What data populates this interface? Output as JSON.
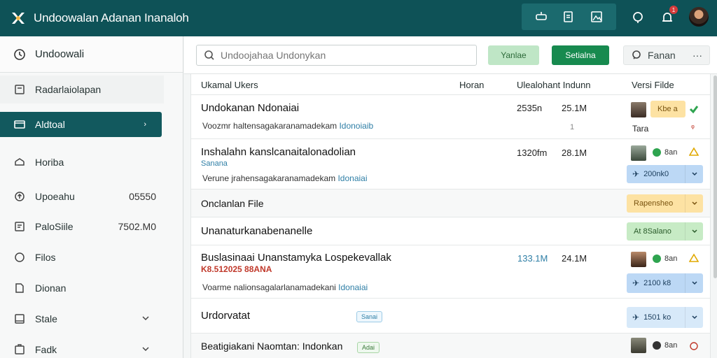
{
  "app": {
    "title": "Undoowalan Adanan Inanaloh",
    "notification_count": "1"
  },
  "topbar": {
    "icons": [
      "share-icon",
      "edit-icon",
      "image-icon",
      "help-icon",
      "bell-icon"
    ]
  },
  "sidebar": {
    "header": "Undoowali",
    "items": [
      {
        "label": "Radarlaiolapan",
        "icon": "card-icon",
        "value": ""
      },
      {
        "label": "Aldtoal",
        "icon": "folder-icon",
        "value": "",
        "active": true
      },
      {
        "label": "Horiba",
        "icon": "stack-icon",
        "value": ""
      },
      {
        "label": "Upoeahu",
        "icon": "upload-icon",
        "value": "05550"
      },
      {
        "label": "PaloSiile",
        "icon": "file-icon",
        "value": "7502.M0"
      },
      {
        "label": "Filos",
        "icon": "tag-icon",
        "value": ""
      },
      {
        "label": "Dionan",
        "icon": "doc-icon",
        "value": ""
      },
      {
        "label": "Stale",
        "icon": "list-icon",
        "value": "",
        "expand": true
      },
      {
        "label": "Fadk",
        "icon": "box-icon",
        "value": "",
        "expand": true
      }
    ]
  },
  "toolbar": {
    "search_placeholder": "Undoojahaa Undonykan",
    "btn_light": "Yanlae",
    "btn_dark": "Setialna",
    "btn_outline": "Fanan",
    "more": "···"
  },
  "table": {
    "headers": {
      "c1": "Ukamal Ukers",
      "c2": "Horan",
      "c3": "Ulealohant Indunn",
      "c4": "Versi Filde"
    },
    "rows": [
      {
        "title": "Undokanan Ndonaiai",
        "subtitle_main": "Voozmr haltensagakaranamadekam ",
        "subtitle_hl": "Idonoiaib",
        "c_time": "2535n",
        "c_size": "25.1M",
        "c_mini": "1",
        "pill": "Kbe a",
        "pill_style": "orange",
        "extra": "Tara"
      },
      {
        "title": "Inshalahn kanslcanaitalonadolian",
        "tag": "Sanana",
        "subtitle_main": "Verune jrahensagakaranamadekam ",
        "subtitle_hl": "Idonaiai",
        "c_time": "1320fm",
        "c_size": "28.1M",
        "status": "8an",
        "pill": "200nk0",
        "pill_style": "blue"
      },
      {
        "title": "Onclanlan File",
        "pill": "Rapensheo",
        "pill_style": "orange"
      },
      {
        "title": "Unanaturkanabenanelle",
        "pill": "At 8Salano",
        "pill_style": "green"
      },
      {
        "title": "Buslasinaai Unanstamyka Lospekevallak",
        "red": "K8.512025 88ANA",
        "subtitle_main": "Voarme nalionsagalarlanamadekani ",
        "subtitle_hl": "Idonaiai",
        "c_time": "133.1M",
        "c_size": "24.1M",
        "status": "8an",
        "pill": "2100 k8",
        "pill_style": "blue"
      },
      {
        "title": "Urdorvatat",
        "chip": "Sanai",
        "pill": "1501 ko",
        "pill_style": "lblue"
      },
      {
        "title": "Beatigiakani Naomtan: Indonkan",
        "chip": "Adai",
        "status": "8an"
      }
    ]
  },
  "colors": {
    "topbar": "#0e5257",
    "active": "#12595e",
    "primary_btn": "#178a4f"
  }
}
